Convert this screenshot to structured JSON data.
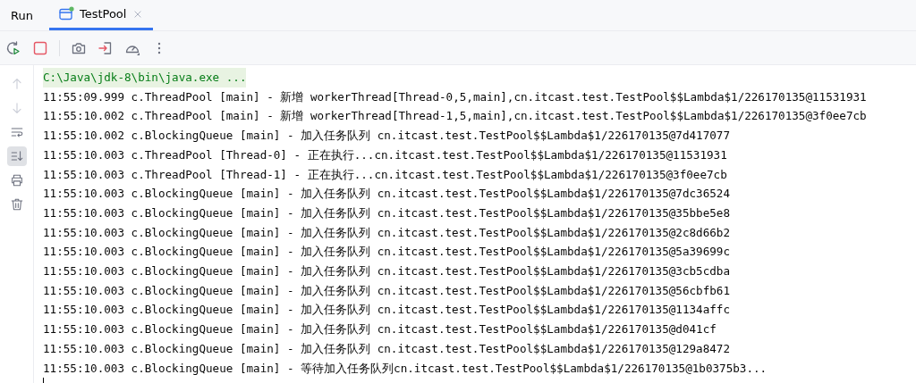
{
  "tool_window": {
    "title": "Run"
  },
  "tabs": [
    {
      "label": "TestPool",
      "selected": true
    }
  ],
  "toolbar": [
    {
      "kind": "rerun"
    },
    {
      "kind": "stop"
    },
    {
      "kind": "separator"
    },
    {
      "kind": "camera"
    },
    {
      "kind": "exit"
    },
    {
      "kind": "gauge"
    },
    {
      "kind": "more"
    }
  ],
  "gutter": [
    {
      "kind": "up",
      "disabled": true,
      "selected": false
    },
    {
      "kind": "down",
      "disabled": true,
      "selected": false
    },
    {
      "kind": "wrap",
      "disabled": false,
      "selected": false
    },
    {
      "kind": "scroll-end",
      "disabled": false,
      "selected": true
    },
    {
      "kind": "print",
      "disabled": false,
      "selected": false
    },
    {
      "kind": "trash",
      "disabled": false,
      "selected": false
    }
  ],
  "console": [
    {
      "kind": "command",
      "text": "C:\\Java\\jdk-8\\bin\\java.exe ..."
    },
    {
      "kind": "log",
      "text": "11:55:09.999 c.ThreadPool [main] - 新增 workerThread[Thread-0,5,main],cn.itcast.test.TestPool$$Lambda$1/226170135@11531931"
    },
    {
      "kind": "log",
      "text": "11:55:10.002 c.ThreadPool [main] - 新增 workerThread[Thread-1,5,main],cn.itcast.test.TestPool$$Lambda$1/226170135@3f0ee7cb"
    },
    {
      "kind": "log",
      "text": "11:55:10.002 c.BlockingQueue [main] - 加入任务队列 cn.itcast.test.TestPool$$Lambda$1/226170135@7d417077"
    },
    {
      "kind": "log",
      "text": "11:55:10.003 c.ThreadPool [Thread-0] - 正在执行...cn.itcast.test.TestPool$$Lambda$1/226170135@11531931"
    },
    {
      "kind": "log",
      "text": "11:55:10.003 c.ThreadPool [Thread-1] - 正在执行...cn.itcast.test.TestPool$$Lambda$1/226170135@3f0ee7cb"
    },
    {
      "kind": "log",
      "text": "11:55:10.003 c.BlockingQueue [main] - 加入任务队列 cn.itcast.test.TestPool$$Lambda$1/226170135@7dc36524"
    },
    {
      "kind": "log",
      "text": "11:55:10.003 c.BlockingQueue [main] - 加入任务队列 cn.itcast.test.TestPool$$Lambda$1/226170135@35bbe5e8"
    },
    {
      "kind": "log",
      "text": "11:55:10.003 c.BlockingQueue [main] - 加入任务队列 cn.itcast.test.TestPool$$Lambda$1/226170135@2c8d66b2"
    },
    {
      "kind": "log",
      "text": "11:55:10.003 c.BlockingQueue [main] - 加入任务队列 cn.itcast.test.TestPool$$Lambda$1/226170135@5a39699c"
    },
    {
      "kind": "log",
      "text": "11:55:10.003 c.BlockingQueue [main] - 加入任务队列 cn.itcast.test.TestPool$$Lambda$1/226170135@3cb5cdba"
    },
    {
      "kind": "log",
      "text": "11:55:10.003 c.BlockingQueue [main] - 加入任务队列 cn.itcast.test.TestPool$$Lambda$1/226170135@56cbfb61"
    },
    {
      "kind": "log",
      "text": "11:55:10.003 c.BlockingQueue [main] - 加入任务队列 cn.itcast.test.TestPool$$Lambda$1/226170135@1134affc"
    },
    {
      "kind": "log",
      "text": "11:55:10.003 c.BlockingQueue [main] - 加入任务队列 cn.itcast.test.TestPool$$Lambda$1/226170135@d041cf"
    },
    {
      "kind": "log",
      "text": "11:55:10.003 c.BlockingQueue [main] - 加入任务队列 cn.itcast.test.TestPool$$Lambda$1/226170135@129a8472"
    },
    {
      "kind": "log",
      "text": "11:55:10.003 c.BlockingQueue [main] - 等待加入任务队列cn.itcast.test.TestPool$$Lambda$1/226170135@1b0375b3..."
    }
  ]
}
